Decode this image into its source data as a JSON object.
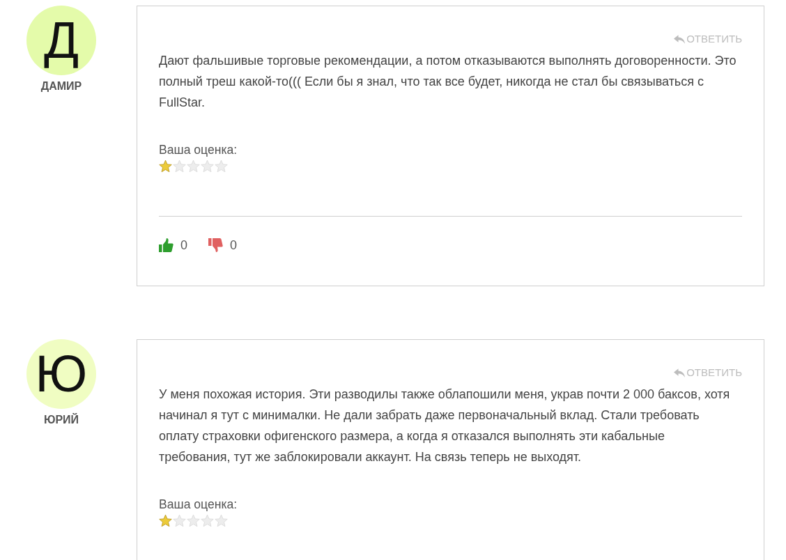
{
  "comments": [
    {
      "author": "ДАМИР",
      "avatar": {
        "letter": "Д",
        "color": "#e4fbaa"
      },
      "reply": "ОТВЕТИТЬ",
      "text": "Дают фальшивые торговые рекомендации, а потом отказываются выполнять договоренности. Это полный треш какой-то((( Если бы я знал, что так все будет, никогда не стал бы связываться с FullStar.",
      "rating_label": "Ваша оценка:",
      "stars": 1,
      "votes": {
        "likes": "0",
        "dislikes": "0"
      }
    },
    {
      "author": "ЮРИЙ",
      "avatar": {
        "letter": "Ю",
        "color": "#f0fdc2"
      },
      "reply": "ОТВЕТИТЬ",
      "text": "У меня похожая история. Эти разводилы также облапошили меня, украв почти 2 000 баксов, хотя начинал я тут с минималки. Не дали забрать даже первоначальный вклад. Стали требовать оплату страховки офигенского размера, а когда я отказался выполнять эти кабальные требования, тут же заблокировали аккаунт. На связь теперь не выходят.",
      "rating_label": "Ваша оценка:",
      "stars": 1
    }
  ]
}
